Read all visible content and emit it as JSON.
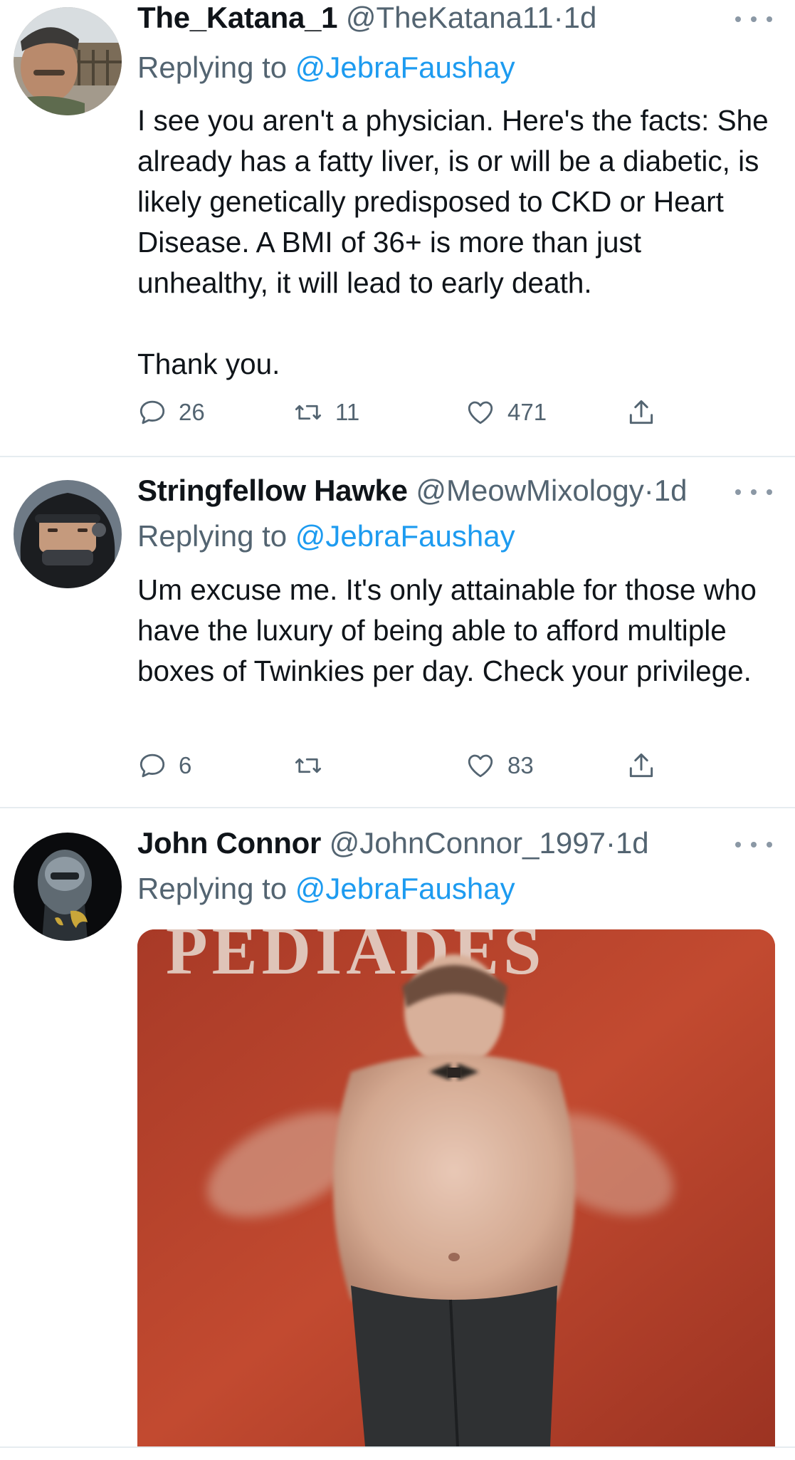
{
  "colors": {
    "text": "#0f1419",
    "secondary": "#536471",
    "link": "#1d9bf0",
    "divider": "#e6ecf0",
    "media_bg": "#b4402c"
  },
  "tweets": [
    {
      "display_name": "The_Katana_1",
      "handle": "@TheKatana11",
      "separator": "·",
      "time": "1d",
      "replying_prefix": "Replying to",
      "replying_to": "@JebraFaushay",
      "paragraphs": [
        "I see you aren't a physician. Here's the facts: She already has a fatty liver, is or will be a diabetic, is likely genetically predisposed to CKD or Heart Disease. A BMI of 36+ is more than just unhealthy, it will lead to early death.",
        "Thank you."
      ],
      "actions": {
        "replies": "26",
        "retweets": "11",
        "likes": "471",
        "share_icon": "share-icon"
      }
    },
    {
      "display_name": "Stringfellow Hawke",
      "handle": "@MeowMixology",
      "separator": "·",
      "time": "1d",
      "replying_prefix": "Replying to",
      "replying_to": "@JebraFaushay",
      "paragraphs": [
        "Um excuse me. It's only attainable for those who have the luxury of being able to afford multiple boxes of Twinkies per day. Check your privilege."
      ],
      "actions": {
        "replies": "6",
        "retweets": "",
        "likes": "83",
        "share_icon": "share-icon"
      }
    },
    {
      "display_name": "John Connor",
      "handle": "@JohnConnor_1997",
      "separator": "·",
      "time": "1d",
      "replying_prefix": "Replying to",
      "replying_to": "@JebraFaushay",
      "media_description_icon": "gif-image",
      "media_sign_text": "PEDIADES"
    }
  ]
}
